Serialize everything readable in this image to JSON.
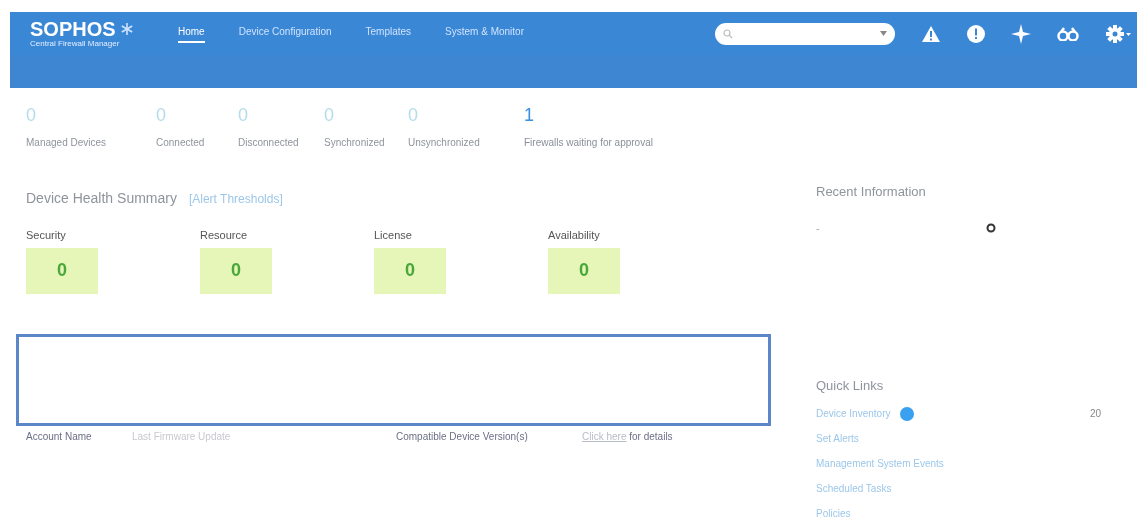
{
  "header": {
    "logo": "SOPHOS",
    "subtitle": "Central Firewall Manager",
    "nav": [
      {
        "label": "Home",
        "selected": true
      },
      {
        "label": "Device Configuration",
        "selected": false
      },
      {
        "label": "Templates",
        "selected": false
      },
      {
        "label": "System & Monitor",
        "selected": false
      }
    ]
  },
  "stats": [
    {
      "value": "0",
      "label": "Managed Devices",
      "kind": "plain"
    },
    {
      "value": "0",
      "label": "Connected",
      "kind": "plain"
    },
    {
      "value": "0",
      "label": "Disconnected",
      "kind": "plain"
    },
    {
      "value": "0",
      "label": "Synchronized",
      "kind": "plain"
    },
    {
      "value": "0",
      "label": "Unsynchronized",
      "kind": "plain"
    },
    {
      "value": "1",
      "label": "Firewalls waiting for approval",
      "kind": "link"
    }
  ],
  "health": {
    "title": "Device Health Summary",
    "link": "[Alert Thresholds]",
    "items": [
      {
        "label": "Security",
        "value": "0"
      },
      {
        "label": "Resource",
        "value": "0"
      },
      {
        "label": "License",
        "value": "0"
      },
      {
        "label": "Availability",
        "value": "0"
      }
    ]
  },
  "info_row": [
    "Account Name",
    "Last Firmware Update",
    "Compatible Device Version(s)"
  ],
  "details": {
    "link": "Click here",
    "text": "for details"
  },
  "recent": {
    "title": "Recent Information",
    "value": "-"
  },
  "quick_links": {
    "title": "Quick Links",
    "items": [
      {
        "label": "Device Inventory",
        "count": "20",
        "badge": true
      },
      {
        "label": "Set Alerts",
        "badge": false
      },
      {
        "label": "Management System Events",
        "badge": false
      },
      {
        "label": "Scheduled Tasks",
        "badge": false
      },
      {
        "label": "Policies",
        "badge": false
      }
    ]
  }
}
